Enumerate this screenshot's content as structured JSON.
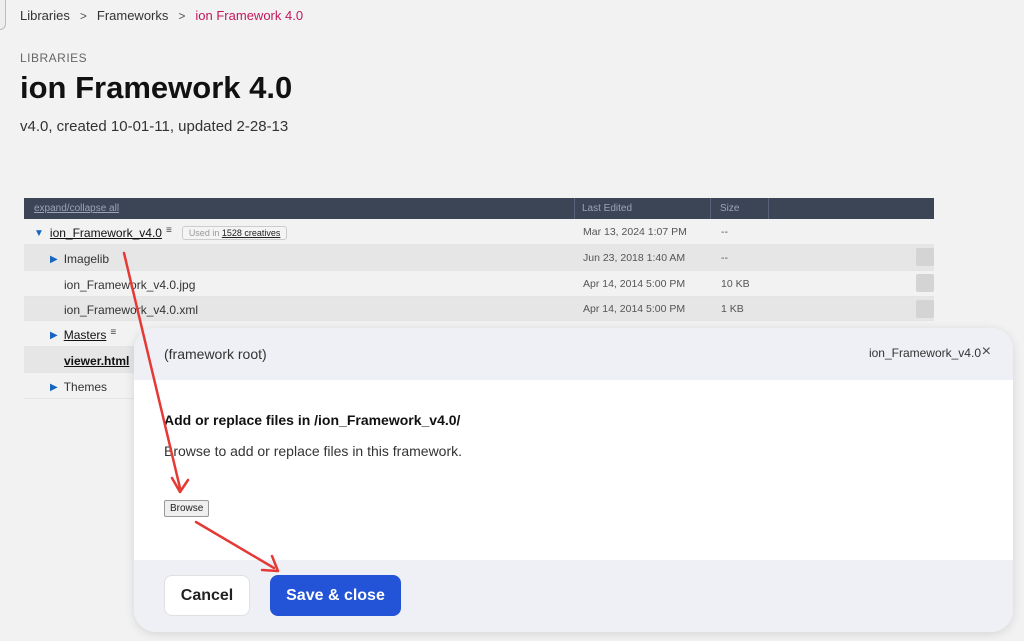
{
  "breadcrumb": {
    "items": [
      "Libraries",
      "Frameworks"
    ],
    "separator": ">",
    "current": "ion Framework 4.0"
  },
  "header": {
    "eyebrow": "LIBRARIES",
    "title": "ion Framework 4.0",
    "subtitle": "v4.0, created 10-01-11, updated 2-28-13"
  },
  "table": {
    "columns": {
      "name": "expand/collapse all",
      "edited": "Last Edited",
      "size": "Size"
    },
    "rows": [
      {
        "name": "ion_Framework_v4.0",
        "menu": "≡",
        "usage_prefix": "Used in",
        "usage_link": "1528 creatives",
        "edited": "Mar 13, 2024 1:07 PM",
        "size": "--"
      },
      {
        "name": "Imagelib",
        "edited": "Jun 23, 2018 1:40 AM",
        "size": "--"
      },
      {
        "name": "ion_Framework_v4.0.jpg",
        "edited": "Apr 14, 2014 5:00 PM",
        "size": "10 KB"
      },
      {
        "name": "ion_Framework_v4.0.xml",
        "edited": "Apr 14, 2014 5:00 PM",
        "size": "1 KB"
      },
      {
        "name": "Masters",
        "menu": "≡"
      },
      {
        "name": "viewer.html"
      },
      {
        "name": "Themes"
      }
    ]
  },
  "modal": {
    "root_label": "(framework root)",
    "path_label": "ion_Framework_v4.0",
    "close_glyph": "×",
    "heading": "Add or replace files in /ion_Framework_v4.0/",
    "description": "Browse to add or replace files in this framework.",
    "browse_label": "Browse",
    "cancel_label": "Cancel",
    "save_label": "Save & close"
  },
  "colors": {
    "accent": "#2353d6",
    "breadcrumb_current": "#c2185b",
    "table_header": "#3b4556",
    "annotation_arrow": "#e53935"
  },
  "icons": {
    "expanded": "triangle-down-icon",
    "collapsed": "triangle-right-icon",
    "menu": "hamburger-menu-icon",
    "close": "close-icon"
  }
}
